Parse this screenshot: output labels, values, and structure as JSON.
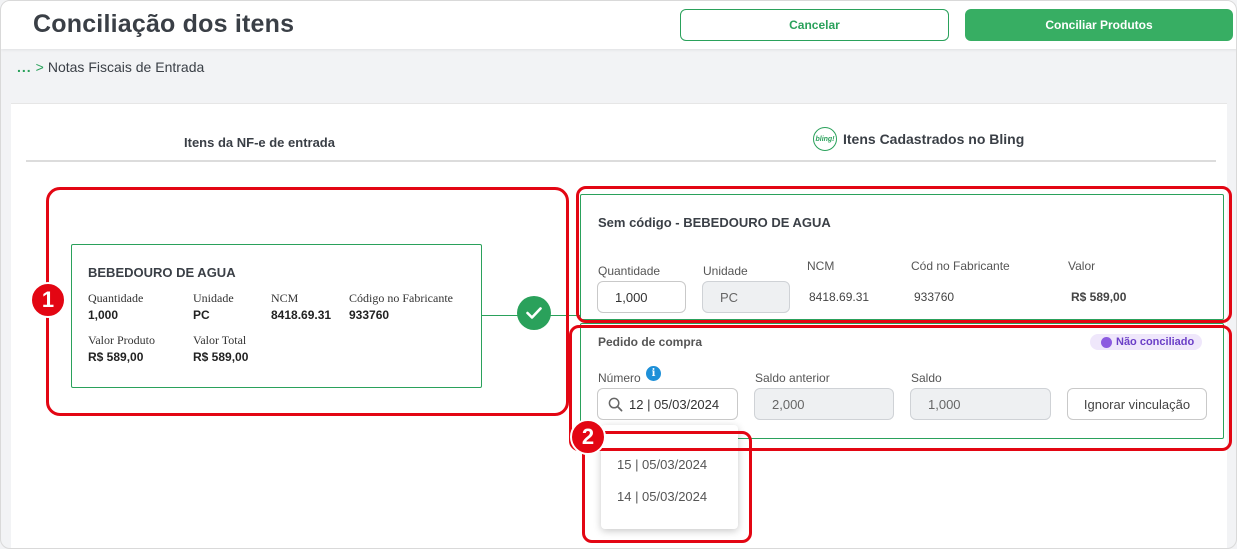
{
  "header": {
    "title": "Conciliação dos itens",
    "cancel_label": "Cancelar",
    "conciliar_label": "Conciliar Produtos",
    "accent": "#37ae63"
  },
  "breadcrumb": {
    "dots": "...",
    "separator": ">",
    "current": "Notas Fiscais de Entrada"
  },
  "tabs": {
    "left": "Itens da NF-e de entrada",
    "right": "Itens Cadastrados no Bling",
    "right_logo_text": "bling!"
  },
  "nfe_item": {
    "title": "BEBEDOURO DE AGUA",
    "fields": [
      {
        "label": "Quantidade",
        "value": "1,000"
      },
      {
        "label": "Unidade",
        "value": "PC"
      },
      {
        "label": "NCM",
        "value": "8418.69.31"
      },
      {
        "label": "Código no Fabricante",
        "value": "933760"
      },
      {
        "label": "Valor Produto",
        "value": "R$ 589,00"
      },
      {
        "label": "Valor Total",
        "value": "R$ 589,00"
      }
    ]
  },
  "bling_item": {
    "title": "Sem código - BEBEDOURO DE AGUA",
    "quantidade_label": "Quantidade",
    "quantidade_value": "1,000",
    "unidade_label": "Unidade",
    "unidade_value": "PC",
    "ncm_label": "NCM",
    "ncm_value": "8418.69.31",
    "cod_fabricante_label": "Cód no Fabricante",
    "cod_fabricante_value": "933760",
    "valor_label": "Valor",
    "valor_value": "R$ 589,00"
  },
  "pedido": {
    "title": "Pedido de compra",
    "status": "Não conciliado",
    "numero_label": "Número",
    "numero_value": "12 | 05/03/2024",
    "saldo_anterior_label": "Saldo anterior",
    "saldo_anterior_value": "2,000",
    "saldo_label": "Saldo",
    "saldo_value": "1,000",
    "ignorar_label": "Ignorar vinculação",
    "options": [
      "15 | 05/03/2024",
      "14 | 05/03/2024"
    ]
  },
  "annotations": {
    "marker_1": "1",
    "marker_2": "2",
    "highlight_color": "#e30613"
  }
}
